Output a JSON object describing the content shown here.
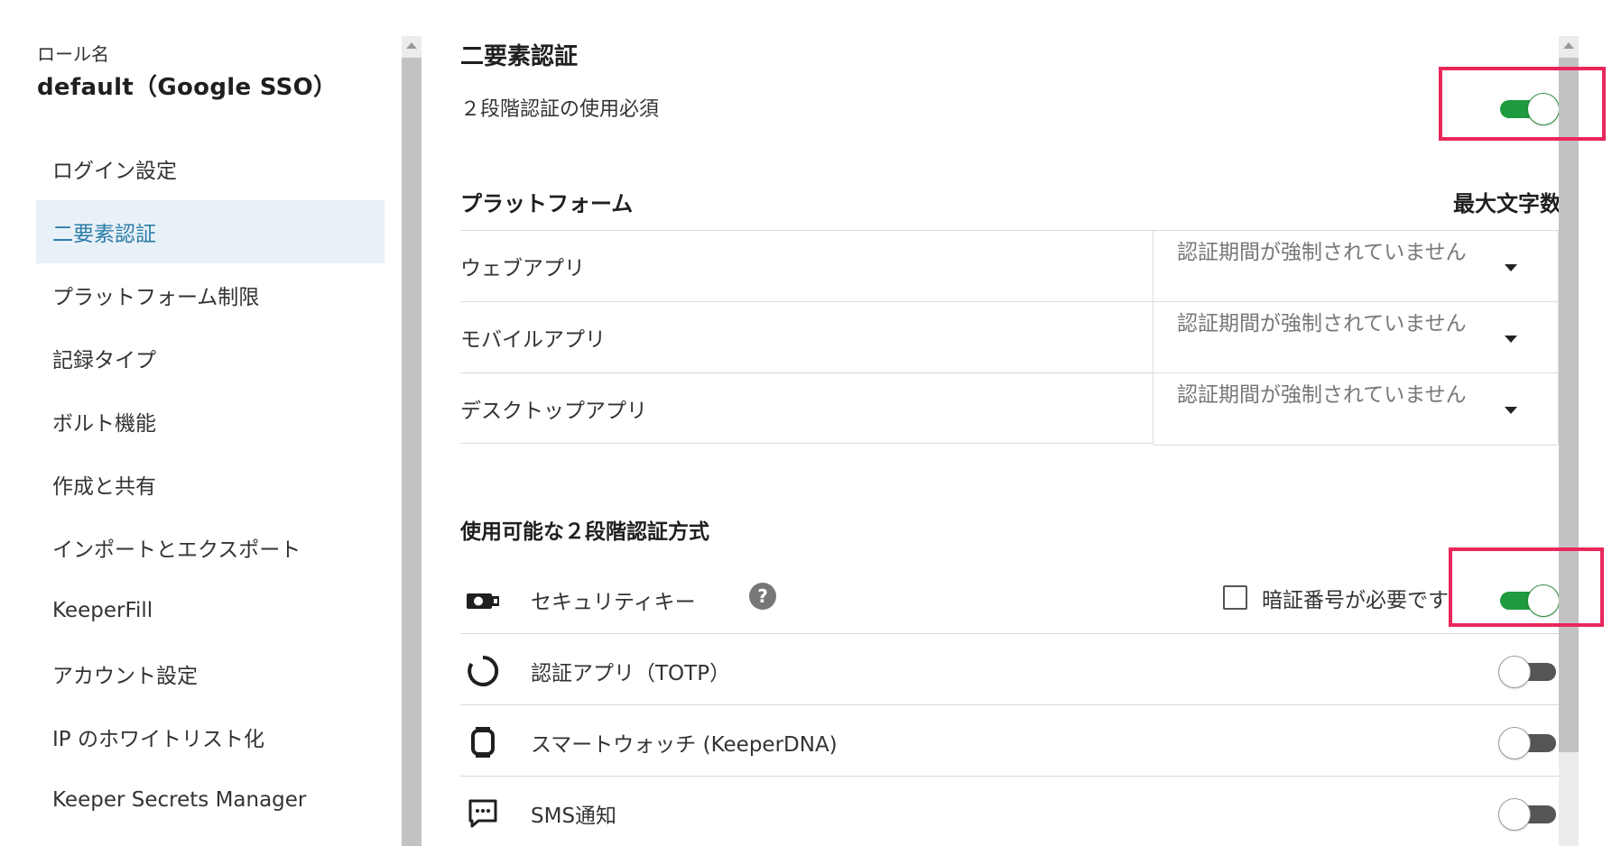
{
  "sidebar": {
    "role_label": "ロール名",
    "role_name": "default（Google SSO）",
    "items": [
      {
        "label": "ログイン設定"
      },
      {
        "label": "二要素認証",
        "active": true
      },
      {
        "label": "プラットフォーム制限"
      },
      {
        "label": "記録タイプ"
      },
      {
        "label": "ボルト機能"
      },
      {
        "label": "作成と共有"
      },
      {
        "label": "インポートとエクスポート"
      },
      {
        "label": "KeeperFill"
      },
      {
        "label": "アカウント設定"
      },
      {
        "label": "IP のホワイトリスト化"
      },
      {
        "label": "Keeper Secrets Manager"
      }
    ]
  },
  "main": {
    "title": "二要素認証",
    "require_2fa": {
      "label": "２段階認証の使用必須",
      "enabled": true
    },
    "platform": {
      "header": "プラットフォーム",
      "header_right": "最大文字数",
      "rows": [
        {
          "name": "ウェブアプリ",
          "value": "認証期間が強制されていません"
        },
        {
          "name": "モバイルアプリ",
          "value": "認証期間が強制されていません"
        },
        {
          "name": "デスクトップアプリ",
          "value": "認証期間が強制されていません"
        }
      ]
    },
    "methods": {
      "header": "使用可能な２段階認証方式",
      "rows": [
        {
          "icon": "security-key-icon",
          "label": "セキュリティキー",
          "help": "?",
          "pin_label": "暗証番号が必要です",
          "pin_checked": false,
          "enabled": true
        },
        {
          "icon": "authenticator-app-icon",
          "label": "認証アプリ（TOTP）",
          "enabled": false
        },
        {
          "icon": "smartwatch-icon",
          "label": "スマートウォッチ (KeeperDNA)",
          "enabled": false
        },
        {
          "icon": "sms-icon",
          "label": "SMS通知",
          "enabled": false
        }
      ]
    }
  },
  "colors": {
    "accent_active_bg": "#e8f1f7",
    "accent_active_text": "#2a7ca8",
    "toggle_on": "#1f9a3f",
    "toggle_off": "#555555",
    "highlight": "#e8275a"
  }
}
